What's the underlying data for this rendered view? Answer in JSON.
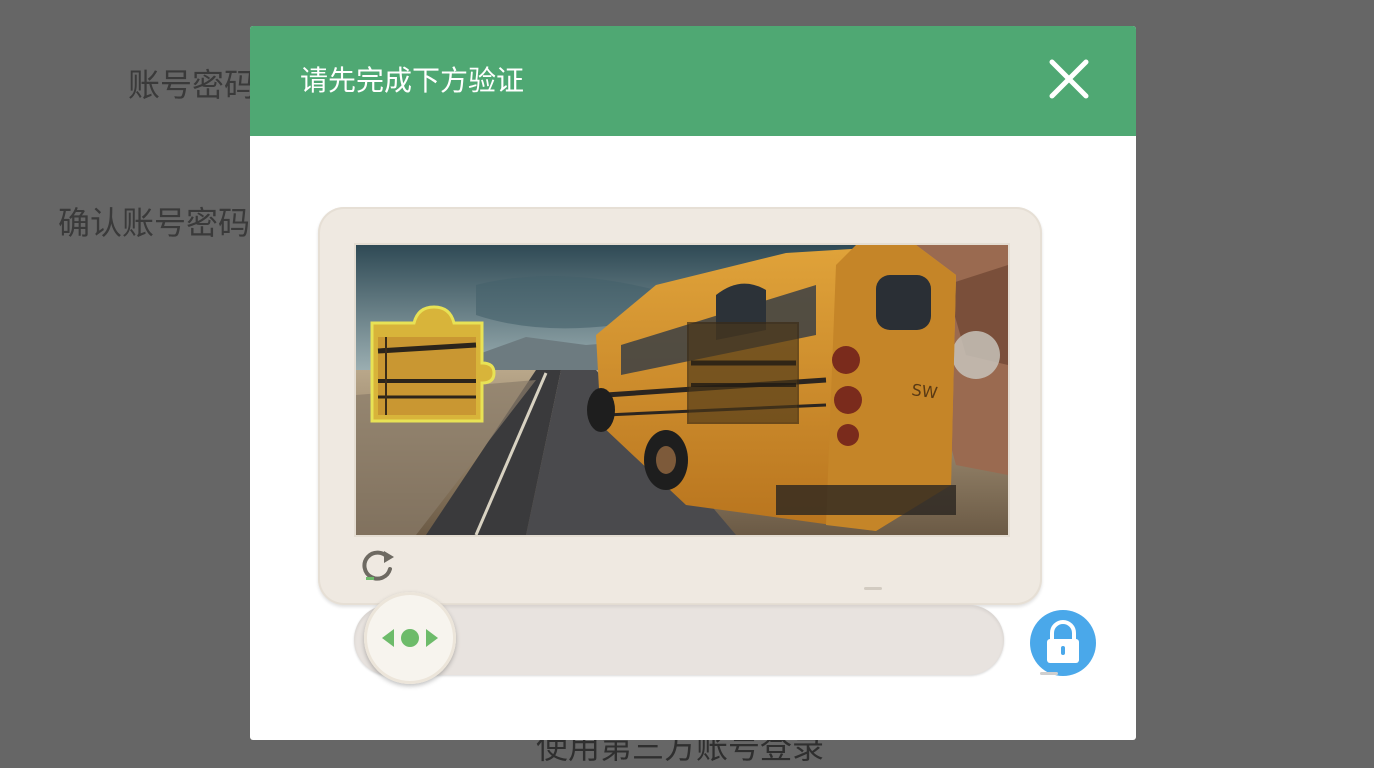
{
  "background": {
    "account_password_label": "账号密码",
    "confirm_password_label": "确认账号密码",
    "third_party_login_label": "使用第三方账号登录"
  },
  "modal": {
    "title": "请先完成下方验证",
    "close_icon": "close-icon"
  },
  "captcha": {
    "image_description": "yellow school bus on desert road",
    "refresh_icon": "refresh-icon",
    "slider_handle_icon": "slider-arrows-icon",
    "lock_icon": "lock-icon",
    "slider_progress": 0
  },
  "colors": {
    "header_green": "#4fa873",
    "lock_blue": "#4aa8ea",
    "handle_green": "#6dbb6a"
  }
}
